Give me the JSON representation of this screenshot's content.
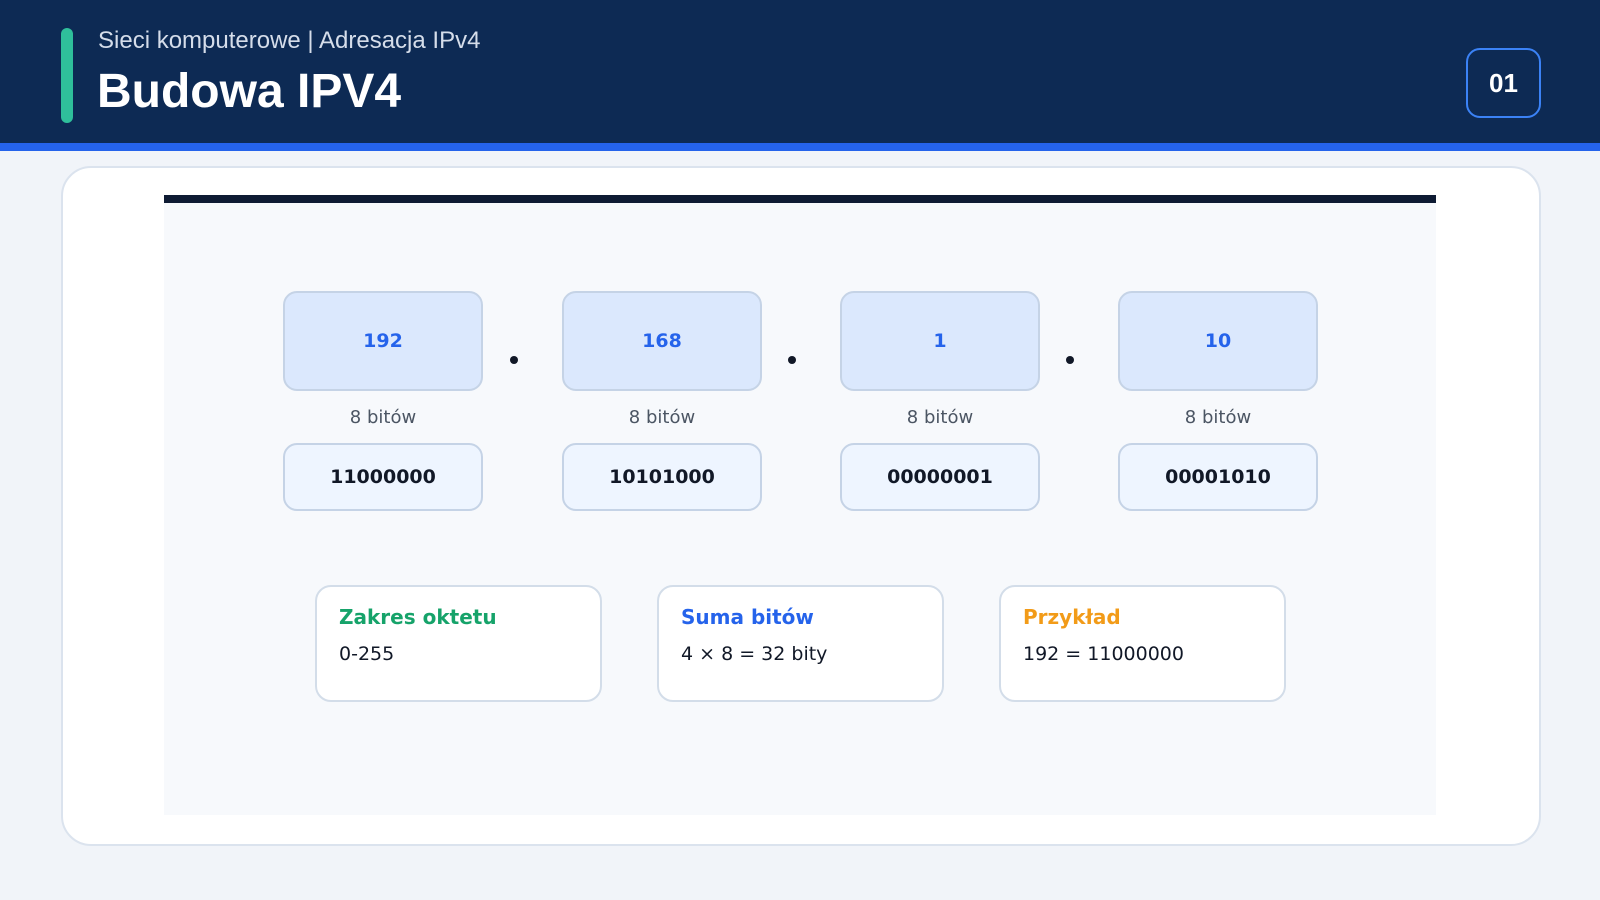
{
  "header": {
    "subtitle": "Sieci komputerowe | Adresacja IPv4",
    "title": "Budowa IPV4",
    "page_number": "01"
  },
  "colors": {
    "header_bg": "#0d2a54",
    "accent_teal": "#2fbf9b",
    "accent_blue": "#2563eb",
    "green": "#16a36a",
    "orange": "#f29b18"
  },
  "octets": [
    {
      "decimal": "192",
      "bits_label": "8 bitów",
      "binary": "11000000"
    },
    {
      "decimal": "168",
      "bits_label": "8 bitów",
      "binary": "10101000"
    },
    {
      "decimal": "1",
      "bits_label": "8 bitów",
      "binary": "00000001"
    },
    {
      "decimal": "10",
      "bits_label": "8 bitów",
      "binary": "00001010"
    }
  ],
  "info_cards": [
    {
      "title": "Zakres oktetu",
      "value": "0-255",
      "color": "#16a36a"
    },
    {
      "title": "Suma bitów",
      "value": "4 × 8 = 32 bity",
      "color": "#2563eb"
    },
    {
      "title": "Przykład",
      "value": "192 = 11000000",
      "color": "#f29b18"
    }
  ]
}
